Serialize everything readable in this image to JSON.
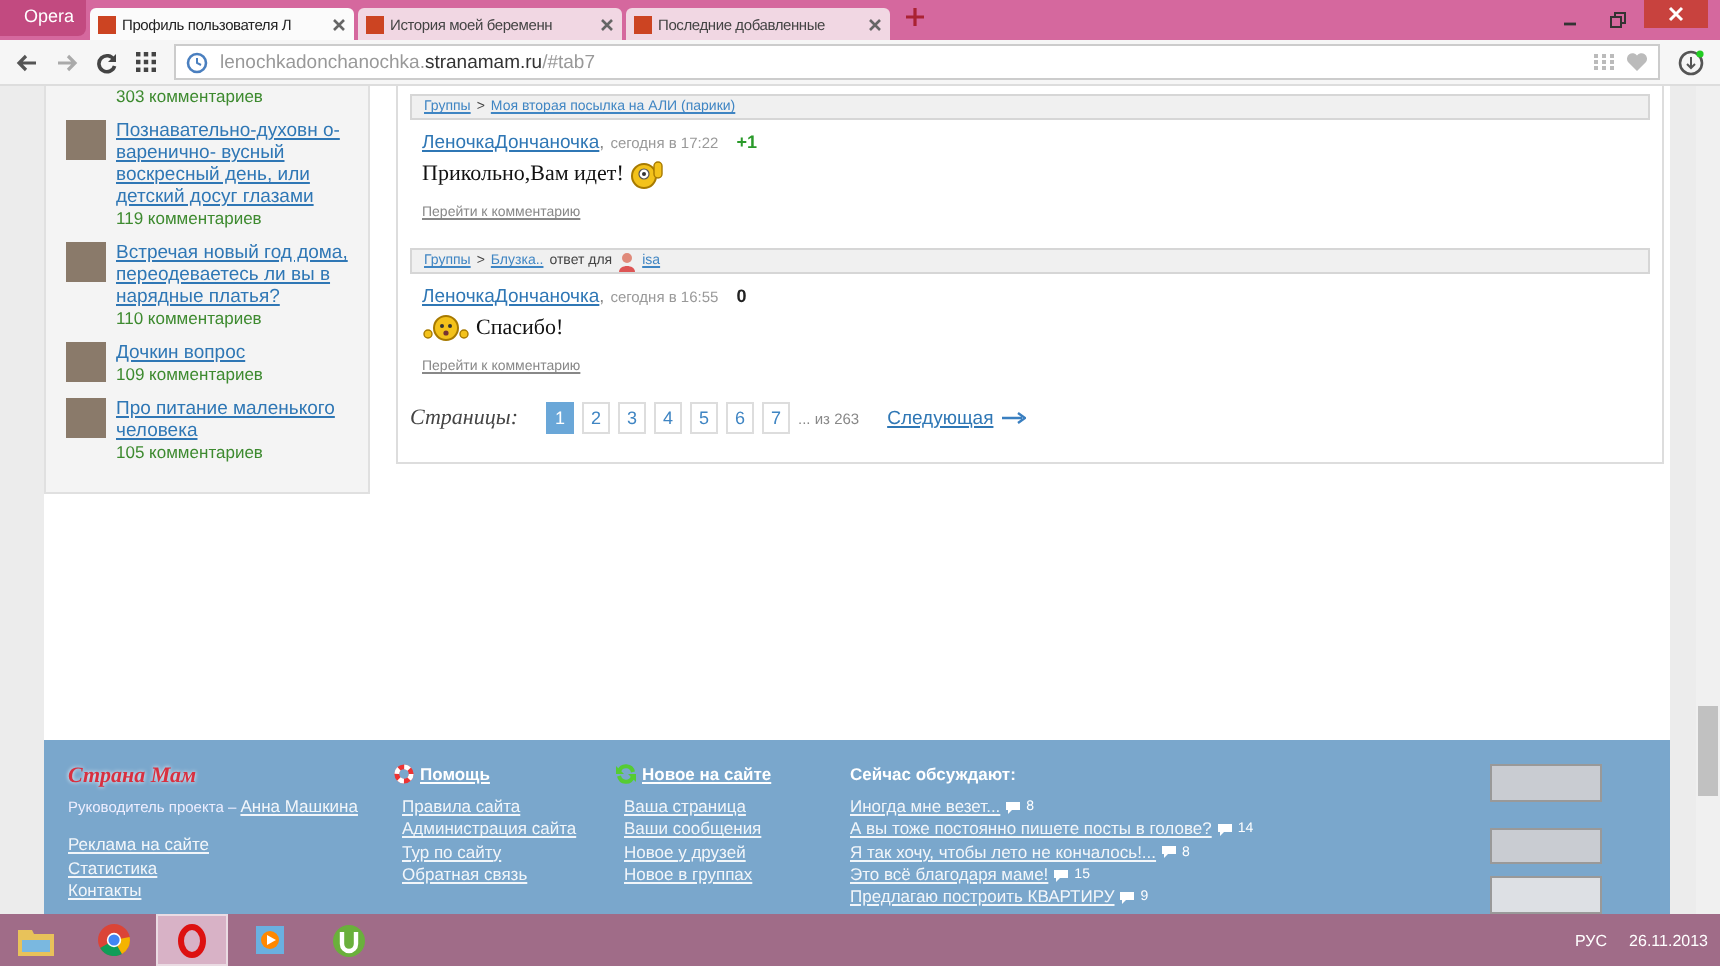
{
  "browser": {
    "menu_label": "Opera",
    "tabs": [
      {
        "title": "Профиль пользователя Л",
        "selected": true
      },
      {
        "title": "История моей беременн",
        "selected": false
      },
      {
        "title": "Последние добавленные",
        "selected": false
      }
    ],
    "url_host": "lenochkadonchanochka.",
    "url_domain": "stranamam.ru",
    "url_path": "/#tab7"
  },
  "sidebar": {
    "items": [
      {
        "comments": "303 комментариев"
      },
      {
        "title": "Познавательно-духовн о-варенично- вусный воскресный день, или детский досуг глазами",
        "comments": "119 комментариев"
      },
      {
        "title": "Встречая новый год дома, переодеваетесь ли вы в нарядные платья?",
        "comments": "110 комментариев"
      },
      {
        "title": "Дочкин вопрос",
        "comments": "109 комментариев"
      },
      {
        "title": "Про питание маленького человека",
        "comments": "105 комментариев"
      }
    ]
  },
  "comments": [
    {
      "group": "Группы",
      "separator": ">",
      "topic": "Моя вторая посылка на АЛИ (парики)",
      "author": "ЛеночкаДончаночка",
      "comma": ",",
      "time": "сегодня в 17:22",
      "rating": "+1",
      "rating_positive": true,
      "body": [
        {
          "kind": "text",
          "text": "Прикольно,Вам идет!"
        },
        {
          "kind": "thumbs_smiley"
        }
      ],
      "link": "Перейти к комментарию"
    },
    {
      "group": "Группы",
      "separator": ">",
      "topic": "Блузка..",
      "reply_label": "ответ для",
      "reply_user": "isa",
      "author": "ЛеночкаДончаночка",
      "comma": ",",
      "time": "сегодня в 16:55",
      "rating": "0",
      "rating_positive": false,
      "body": [
        {
          "kind": "dancing_smiley"
        },
        {
          "kind": "text",
          "text": "Спасибо!"
        }
      ],
      "link": "Перейти к комментарию"
    }
  ],
  "pagination": {
    "label": "Страницы:",
    "pages": [
      {
        "label": "1",
        "selected": true
      },
      {
        "label": "2",
        "selected": false
      },
      {
        "label": "3",
        "selected": false
      },
      {
        "label": "4",
        "selected": false
      },
      {
        "label": "5",
        "selected": false
      },
      {
        "label": "6",
        "selected": false
      },
      {
        "label": "7",
        "selected": false
      }
    ],
    "total": "... из 263",
    "next": "Следующая"
  },
  "footer": {
    "logo": "Страна Мам",
    "lead_label": "Руководитель проекта –",
    "lead_name": "Анна Машкина",
    "links": [
      "Реклама на сайте",
      "Статистика",
      "Контакты"
    ],
    "help": {
      "title": "Помощь",
      "links": [
        "Правила сайта",
        "Администрация сайта",
        "Тур по сайту",
        "Обратная связь"
      ]
    },
    "news": {
      "title": "Новое на сайте",
      "links": [
        "Ваша страница",
        "Ваши сообщения",
        "Новое у друзей",
        "Новое в группах"
      ]
    },
    "discussed": {
      "title": "Сейчас обсуждают:",
      "items": [
        {
          "title": "Иногда мне везет...",
          "count": "8"
        },
        {
          "title": "А вы тоже постоянно пишете посты в голове?",
          "count": "14"
        },
        {
          "title": "Я так хочу, чтобы лето не кончалось!...",
          "count": "8"
        },
        {
          "title": "Это всё благодаря маме!",
          "count": "15"
        },
        {
          "title": "Предлагаю построить КВАРТИРУ",
          "count": "9"
        }
      ]
    }
  },
  "taskbar": {
    "apps": [
      {
        "kind": "folder",
        "selected": false
      },
      {
        "kind": "chrome",
        "selected": false
      },
      {
        "kind": "opera",
        "selected": true
      },
      {
        "kind": "player",
        "selected": false
      },
      {
        "kind": "torrent",
        "selected": false
      }
    ],
    "language": "РУС",
    "date": "26.11.2013"
  }
}
